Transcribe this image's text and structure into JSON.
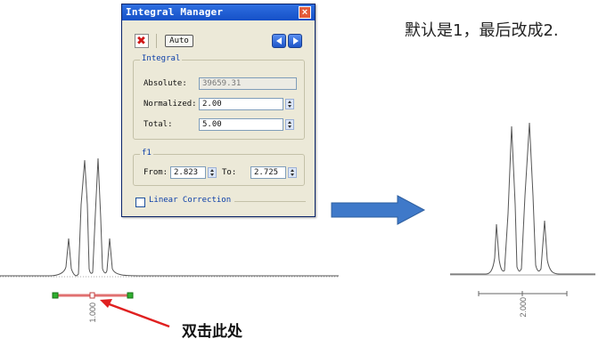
{
  "annotations": {
    "top_note": "默认是1，最后改成2.",
    "bottom_note": "双击此处"
  },
  "dialog": {
    "title": "Integral Manager",
    "auto_label": "Auto",
    "integral_group_label": "Integral",
    "absolute_label": "Absolute:",
    "absolute_value": "39659.31",
    "normalized_label": "Normalized:",
    "normalized_value": "2.00",
    "total_label": "Total:",
    "total_value": "5.00",
    "f1_group_label": "f1",
    "from_label": "From:",
    "from_value": "2.823",
    "to_label": "To:",
    "to_value": "2.725",
    "linear_correction_label": "Linear Correction",
    "linear_correction_checked": false
  },
  "spectra": {
    "left_integral_label": "1.000",
    "right_integral_label": "2.000"
  },
  "colors": {
    "accent_blue": "#3f79c9",
    "annotation_red": "#e02020",
    "handle_green": "#2fb02f"
  }
}
